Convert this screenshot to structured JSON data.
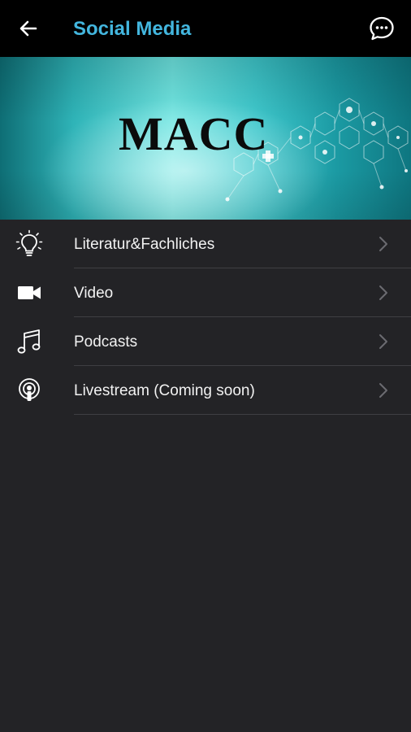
{
  "header": {
    "title": "Social Media",
    "back_icon": "back-arrow-icon",
    "chat_icon": "chat-bubble-icon",
    "title_color": "#43b6de"
  },
  "banner": {
    "logo_text": "MACC"
  },
  "menu": {
    "items": [
      {
        "label": "Literatur&Fachliches",
        "icon": "lightbulb-icon"
      },
      {
        "label": "Video",
        "icon": "video-camera-icon"
      },
      {
        "label": "Podcasts",
        "icon": "music-note-icon"
      },
      {
        "label": "Livestream (Coming soon)",
        "icon": "podcast-broadcast-icon"
      }
    ]
  }
}
